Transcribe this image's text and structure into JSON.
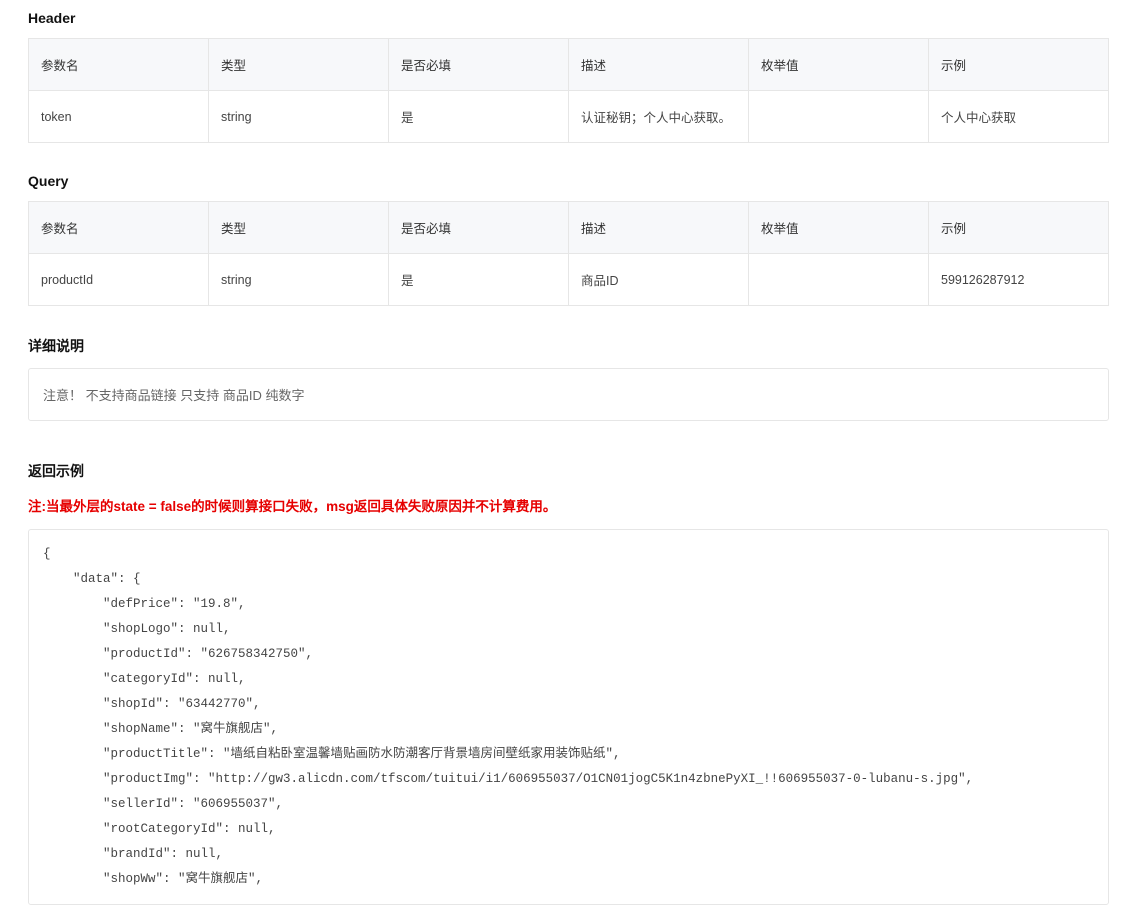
{
  "sections": {
    "header_title": "Header",
    "query_title": "Query",
    "detail_title": "详细说明",
    "return_title": "返回示例"
  },
  "table_headers": {
    "col1": "参数名",
    "col2": "类型",
    "col3": "是否必填",
    "col4": "描述",
    "col5": "枚举值",
    "col6": "示例"
  },
  "header_row": {
    "name": "token",
    "type": "string",
    "required": "是",
    "desc": "认证秘钥；个人中心获取。",
    "enum": "",
    "example": "个人中心获取"
  },
  "query_row": {
    "name": "productId",
    "type": "string",
    "required": "是",
    "desc": "商品ID",
    "enum": "",
    "example": "599126287912"
  },
  "detail_note": "注意！ 不支持商品链接 只支持 商品ID 纯数字",
  "warning_text": "注:当最外层的state = false的时候则算接口失败，msg返回具体失败原因并不计算费用。",
  "code_sample": "{\n    \"data\": {\n        \"defPrice\": \"19.8\",\n        \"shopLogo\": null,\n        \"productId\": \"626758342750\",\n        \"categoryId\": null,\n        \"shopId\": \"63442770\",\n        \"shopName\": \"窝牛旗舰店\",\n        \"productTitle\": \"墙纸自粘卧室温馨墙贴画防水防潮客厅背景墙房间壁纸家用装饰贴纸\",\n        \"productImg\": \"http://gw3.alicdn.com/tfscom/tuitui/i1/606955037/O1CN01jogC5K1n4zbnePyXI_!!606955037-0-lubanu-s.jpg\",\n        \"sellerId\": \"606955037\",\n        \"rootCategoryId\": null,\n        \"brandId\": null,\n        \"shopWw\": \"窝牛旗舰店\","
}
